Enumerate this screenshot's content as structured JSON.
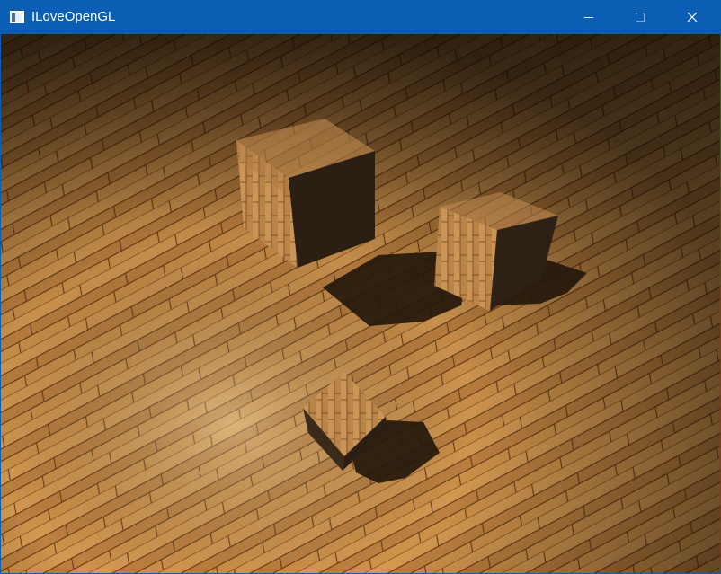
{
  "window": {
    "title": "ILoveOpenGL",
    "titlebar_color": "#0a5fb4",
    "icons": {
      "app": "app-window-icon",
      "minimize": "minimize-icon",
      "maximize": "maximize-icon",
      "close": "close-icon"
    }
  },
  "scene": {
    "floor_color": "#c88a40",
    "shadow_color": "#24180c",
    "object_count": 3
  }
}
